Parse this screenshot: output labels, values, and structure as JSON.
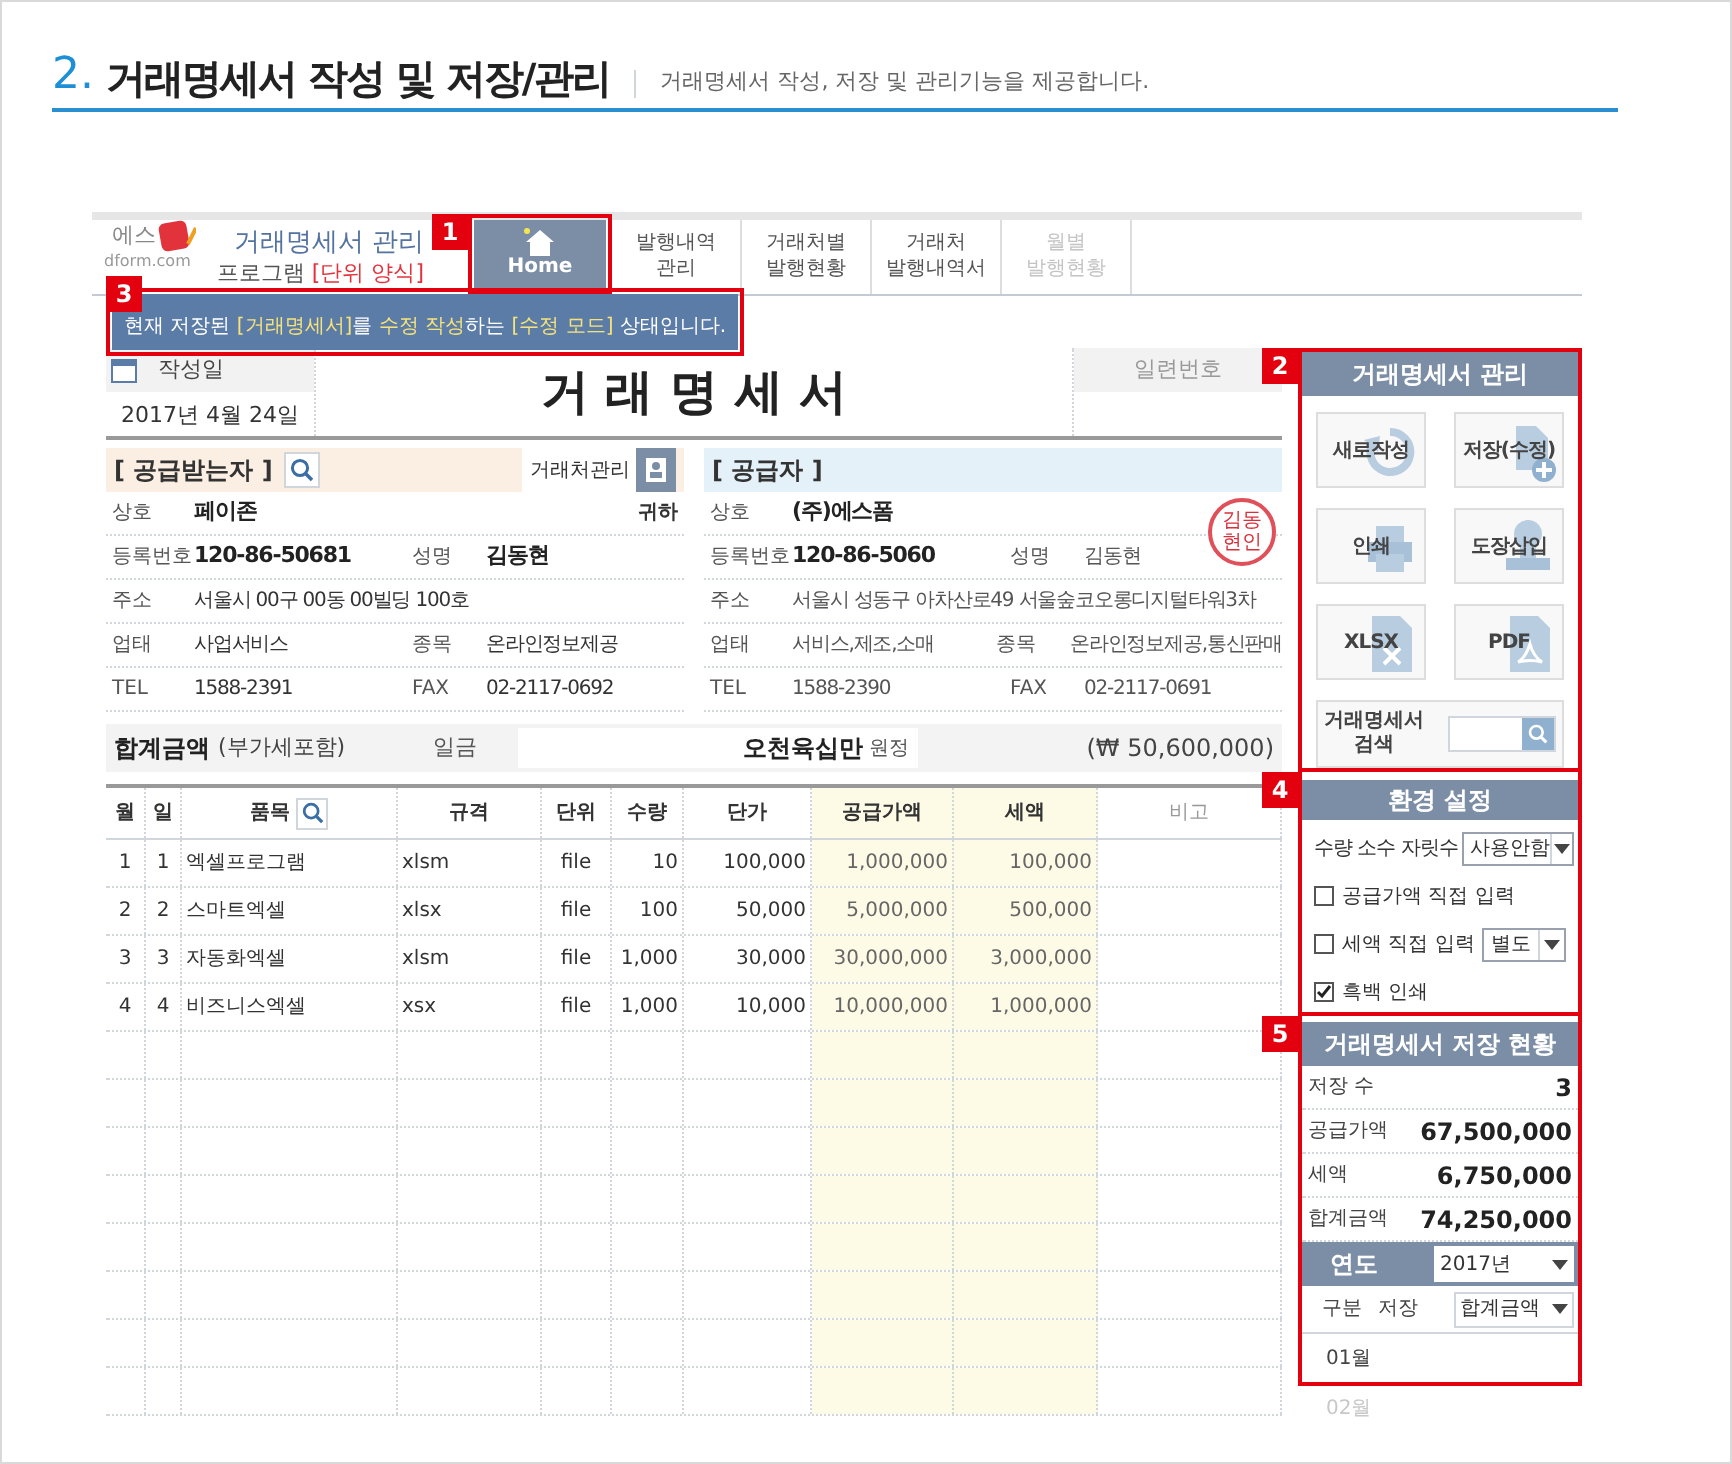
{
  "header": {
    "number": "2.",
    "title": "거래명세서 작성 및 저장/관리",
    "subtitle": "거래명세서 작성, 저장 및 관리기능을 제공합니다."
  },
  "logo": {
    "text": "에스",
    "site": "dform.com"
  },
  "program": {
    "title": "거래명세서 관리",
    "subtitle": "프로그램",
    "form": "[단위 양식]"
  },
  "nav": {
    "badge": "1",
    "tabs": [
      {
        "label": "Home",
        "selected": true,
        "disabled": false
      },
      {
        "label": "발행내역\n관리",
        "selected": false,
        "disabled": false
      },
      {
        "label": "거래처별\n발행현황",
        "selected": false,
        "disabled": false
      },
      {
        "label": "거래처\n발행내역서",
        "selected": false,
        "disabled": false
      },
      {
        "label": "월별\n발행현황",
        "selected": false,
        "disabled": true
      }
    ]
  },
  "notice": {
    "badge": "3",
    "segments": [
      {
        "text": "현재 저장된 ",
        "highlight": false
      },
      {
        "text": "[거래명세서]",
        "highlight": true
      },
      {
        "text": "를 ",
        "highlight": false
      },
      {
        "text": "수정 작성",
        "highlight": true
      },
      {
        "text": "하는 ",
        "highlight": false
      },
      {
        "text": "[수정 모드]",
        "highlight": true
      },
      {
        "text": " 상태입니다.",
        "highlight": false
      }
    ]
  },
  "document": {
    "date_label": "작성일",
    "date": "2017년 4월 24일",
    "title": "거 래 명 세 서",
    "serial_label": "일련번호"
  },
  "buyer": {
    "title": "[ 공급받는자 ]",
    "manage_button": "거래처관리",
    "rows": [
      {
        "cells": [
          {
            "label": "상호",
            "value": "페이존",
            "bold": true
          }
        ],
        "suffix": "귀하"
      },
      {
        "cells": [
          {
            "label": "등록번호",
            "value": "120-86-50681",
            "bold": true
          },
          {
            "label": "성명",
            "value": "김동현",
            "bold": true
          }
        ]
      },
      {
        "cells": [
          {
            "label": "주소",
            "value": "서울시 00구 00동 00빌딩 100호",
            "bold": false
          }
        ]
      },
      {
        "cells": [
          {
            "label": "업태",
            "value": "사업서비스",
            "bold": false
          },
          {
            "label": "종목",
            "value": "온라인정보제공",
            "bold": false
          }
        ]
      },
      {
        "cells": [
          {
            "label": "TEL",
            "value": "1588-2391",
            "bold": false
          },
          {
            "label": "FAX",
            "value": "02-2117-0692",
            "bold": false
          }
        ]
      }
    ]
  },
  "seller": {
    "title": "[ 공급자 ]",
    "stamp": "김동현인",
    "rows": [
      {
        "cells": [
          {
            "label": "상호",
            "value": "(주)에스폼",
            "bold": true
          }
        ]
      },
      {
        "cells": [
          {
            "label": "등록번호",
            "value": "120-86-5060",
            "bold": true
          },
          {
            "label": "성명",
            "value": "김동현",
            "bold": false
          }
        ]
      },
      {
        "cells": [
          {
            "label": "주소",
            "value": "서울시 성동구 아차산로49 서울숲코오롱디지털타워3차",
            "bold": false
          }
        ]
      },
      {
        "cells": [
          {
            "label": "업태",
            "value": "서비스,제조,소매",
            "bold": false
          },
          {
            "label": "종목",
            "value": "온라인정보제공,통신판매",
            "bold": false
          }
        ]
      },
      {
        "cells": [
          {
            "label": "TEL",
            "value": "1588-2390",
            "bold": false
          },
          {
            "label": "FAX",
            "value": "02-2117-0691",
            "bold": false
          }
        ]
      }
    ]
  },
  "total": {
    "label": "합계금액",
    "note": "(부가세포함)",
    "prefix": "일금",
    "amount_words": "오천육십만",
    "suffix": "원정",
    "amount": "(₩ 50,600,000)"
  },
  "items": {
    "columns": [
      "월",
      "일",
      "품목",
      "규격",
      "단위",
      "수량",
      "단가",
      "공급가액",
      "세액",
      "비고"
    ],
    "rows": [
      [
        "1",
        "1",
        "엑셀프로그램",
        "xlsm",
        "file",
        "10",
        "100,000",
        "1,000,000",
        "100,000"
      ],
      [
        "2",
        "2",
        "스마트엑셀",
        "xlsx",
        "file",
        "100",
        "50,000",
        "5,000,000",
        "500,000"
      ],
      [
        "3",
        "3",
        "자동화엑셀",
        "xlsm",
        "file",
        "1,000",
        "30,000",
        "30,000,000",
        "3,000,000"
      ],
      [
        "4",
        "4",
        "비즈니스엑셀",
        "xsx",
        "file",
        "1,000",
        "10,000",
        "10,000,000",
        "1,000,000"
      ]
    ]
  },
  "manage": {
    "badge": "2",
    "title": "거래명세서 관리",
    "buttons": [
      {
        "label": "새로작성",
        "kind": "refresh"
      },
      {
        "label": "저장(수정)",
        "kind": "save"
      },
      {
        "label": "인쇄",
        "kind": "print"
      },
      {
        "label": "도장삽입",
        "kind": "stamp"
      },
      {
        "label": "XLSX",
        "kind": "xlsx"
      },
      {
        "label": "PDF",
        "kind": "pdf"
      }
    ],
    "search_label": "거래명세서\n검색"
  },
  "settings": {
    "badge": "4",
    "title": "환경 설정",
    "options": [
      {
        "kind": "select",
        "label": "수량 소수 자릿수",
        "value": "사용안함"
      },
      {
        "kind": "checkbox",
        "label": "공급가액 직접 입력",
        "checked": false
      },
      {
        "kind": "checkbox_select",
        "label": "세액 직접 입력",
        "checked": false,
        "value": "별도"
      },
      {
        "kind": "checkbox",
        "label": "흑백 인쇄",
        "checked": true
      }
    ]
  },
  "status": {
    "badge": "5",
    "title": "거래명세서 저장 현황",
    "stats": [
      {
        "label": "저장 수",
        "value": "3"
      },
      {
        "label": "공급가액",
        "value": "67,500,000"
      },
      {
        "label": "세액",
        "value": "6,750,000"
      },
      {
        "label": "합계금액",
        "value": "74,250,000"
      }
    ],
    "year_label": "연도",
    "year": "2017년",
    "col_label": "구분",
    "save_label": "저장",
    "measure": "합계금액",
    "months": [
      {
        "label": "01월",
        "faded": false
      },
      {
        "label": "02월",
        "faded": true
      }
    ]
  }
}
